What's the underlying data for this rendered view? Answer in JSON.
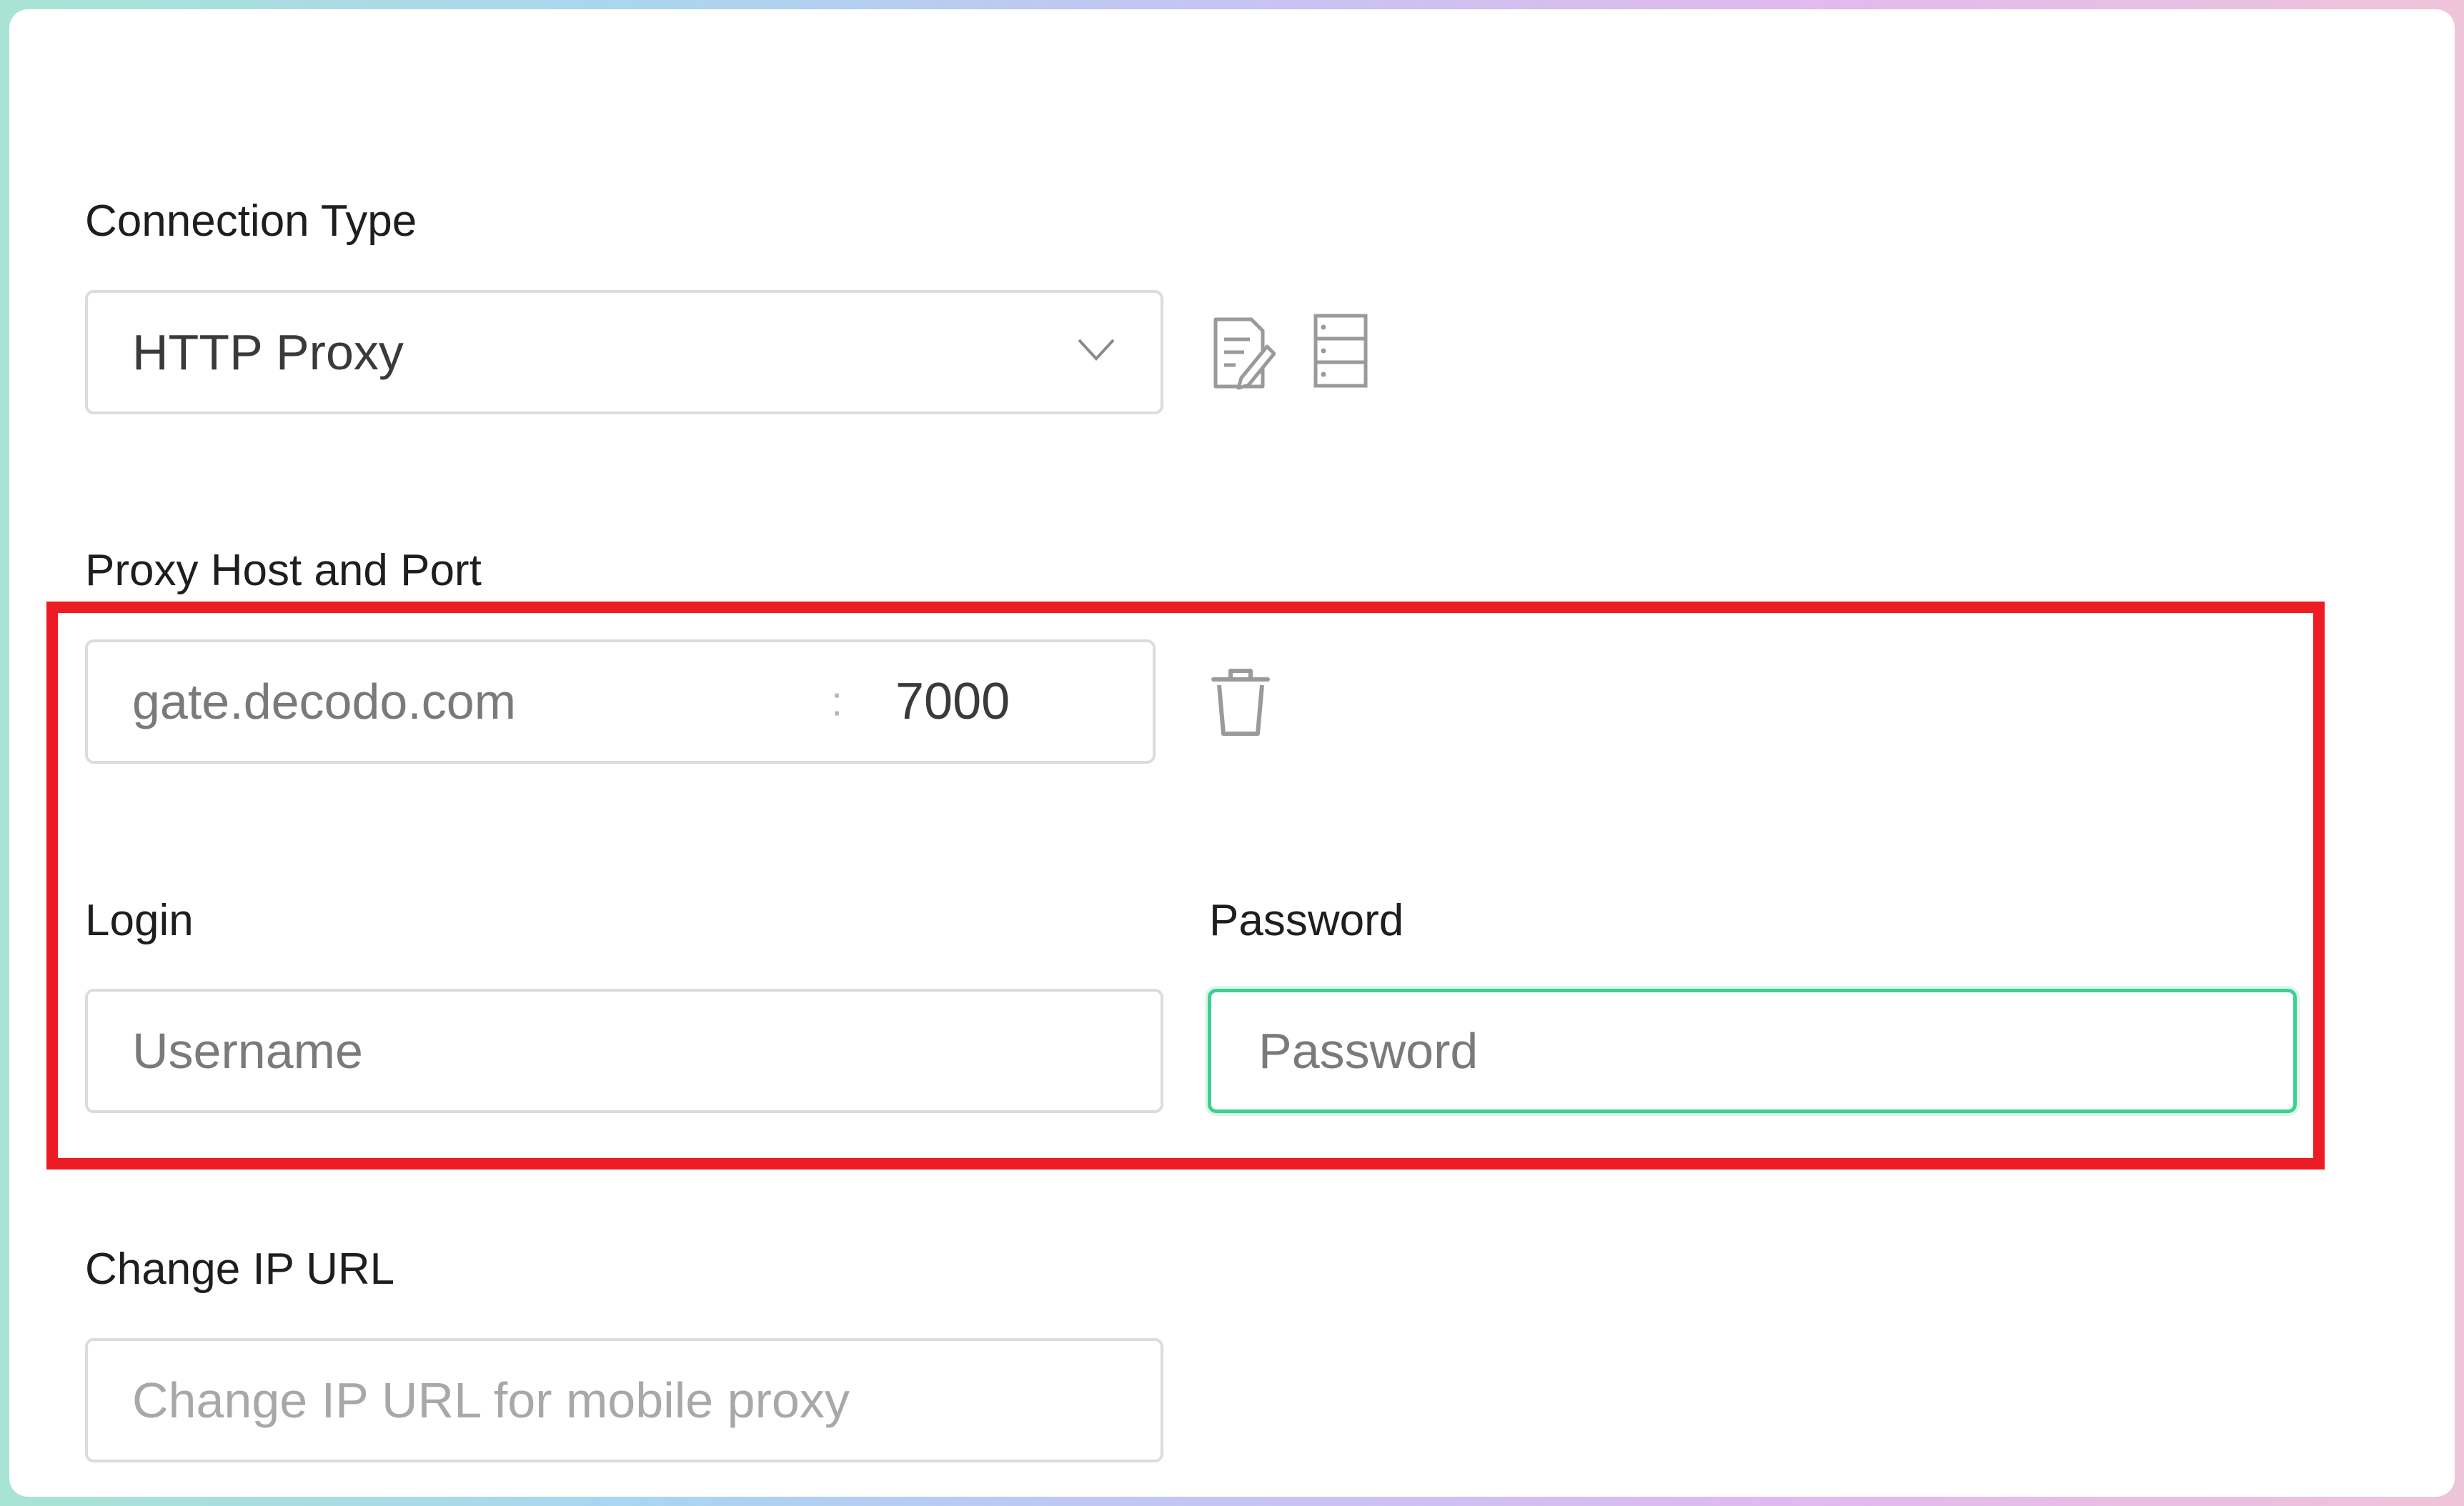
{
  "connection": {
    "label": "Connection Type",
    "selected": "HTTP Proxy"
  },
  "proxy": {
    "label": "Proxy Host and Port",
    "host": "gate.decodo.com",
    "separator": ":",
    "port": "7000"
  },
  "login": {
    "label": "Login",
    "placeholder": "Username"
  },
  "password": {
    "label": "Password",
    "placeholder": "Password"
  },
  "change_ip": {
    "label": "Change IP URL",
    "placeholder": "Change IP URL for mobile proxy"
  },
  "icons": {
    "edit": "edit-notes-icon",
    "list": "server-list-icon",
    "delete": "trash-icon",
    "dropdown": "chevron-down-icon"
  },
  "colors": {
    "highlight": "#ed1c24",
    "focus": "#3fcf8e"
  }
}
